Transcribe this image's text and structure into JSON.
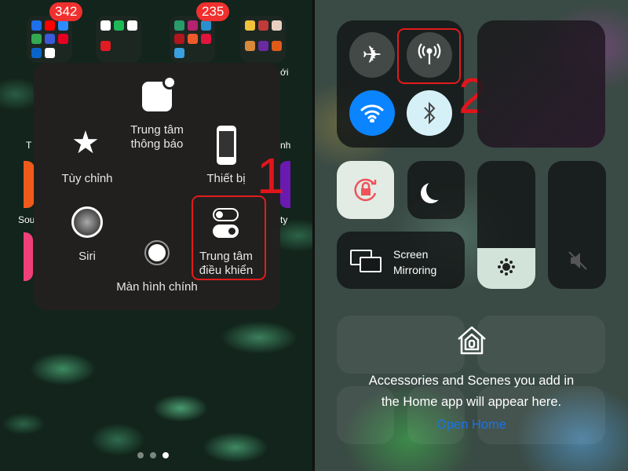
{
  "left_screen": {
    "badges": [
      "342",
      "235"
    ],
    "partial_labels": [
      "T",
      "nh",
      "Sou",
      "ty",
      "ới"
    ],
    "assistive_menu": {
      "items": [
        {
          "id": "notification-center",
          "label_line1": "Trung tâm",
          "label_line2": "thông báo",
          "icon": "notification-icon"
        },
        {
          "id": "customize",
          "label": "Tùy chỉnh",
          "icon": "star-icon"
        },
        {
          "id": "device",
          "label": "Thiết bị",
          "icon": "iphone-icon"
        },
        {
          "id": "siri",
          "label": "Siri",
          "icon": "siri-icon"
        },
        {
          "id": "home",
          "label": "Màn hình chính",
          "icon": "home-button-icon"
        },
        {
          "id": "control-center",
          "label_line1": "Trung tâm",
          "label_line2": "điều khiển",
          "icon": "toggles-icon"
        }
      ]
    },
    "step_number": "1",
    "page_dots": {
      "count": 3,
      "active": 3
    }
  },
  "right_screen": {
    "connectivity": {
      "airplane": false,
      "cellular": false,
      "wifi": true,
      "bluetooth": true
    },
    "step_number": "2",
    "screen_mirroring_line1": "Screen",
    "screen_mirroring_line2": "Mirroring",
    "brightness_percent": 32,
    "volume_muted": true,
    "home_message_line1": "Accessories and Scenes you add in",
    "home_message_line2": "the Home app will appear here.",
    "open_home": "Open Home",
    "colors": {
      "wifi_active": "#0a84ff",
      "link": "#1a73e8",
      "annotation": "#e2141b"
    }
  }
}
